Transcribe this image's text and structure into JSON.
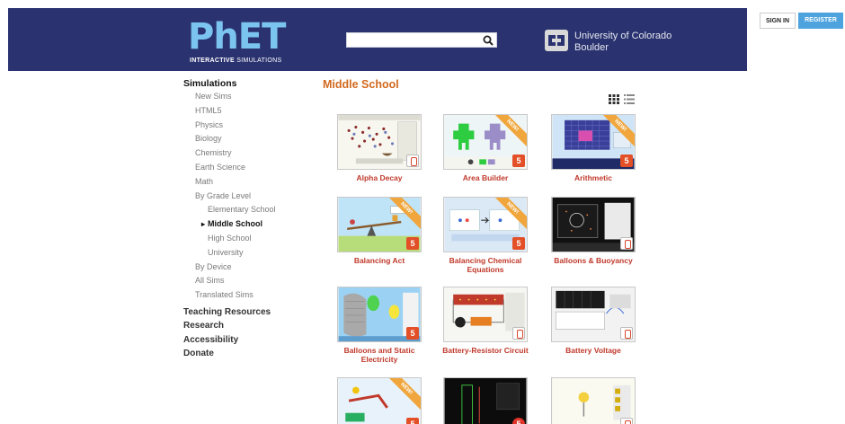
{
  "header": {
    "logo_main": "PhET",
    "logo_sub_bold": "INTERACTIVE",
    "logo_sub_rest": " SIMULATIONS",
    "search_placeholder": "",
    "university_line1": "University of Colorado",
    "university_line2": "Boulder",
    "sign_in": "SIGN IN",
    "register": "REGISTER"
  },
  "sidebar": {
    "heading": "Simulations",
    "items": [
      {
        "label": "New Sims",
        "level": 1
      },
      {
        "label": "HTML5",
        "level": 1
      },
      {
        "label": "Physics",
        "level": 1
      },
      {
        "label": "Biology",
        "level": 1
      },
      {
        "label": "Chemistry",
        "level": 1
      },
      {
        "label": "Earth Science",
        "level": 1
      },
      {
        "label": "Math",
        "level": 1
      },
      {
        "label": "By Grade Level",
        "level": 1
      },
      {
        "label": "Elementary School",
        "level": 2
      },
      {
        "label": "Middle School",
        "level": 2,
        "active": true
      },
      {
        "label": "High School",
        "level": 2
      },
      {
        "label": "University",
        "level": 2
      },
      {
        "label": "By Device",
        "level": 1
      },
      {
        "label": "All Sims",
        "level": 1
      },
      {
        "label": "Translated Sims",
        "level": 1
      }
    ],
    "sections": [
      "Teaching Resources",
      "Research",
      "Accessibility",
      "Donate"
    ]
  },
  "main": {
    "title": "Middle School",
    "view_modes": [
      "grid-icon",
      "list-icon"
    ],
    "sims": [
      {
        "label": "Alpha Decay",
        "badge": "java",
        "new": false
      },
      {
        "label": "Area Builder",
        "badge": "html5",
        "new": true
      },
      {
        "label": "Arithmetic",
        "badge": "html5",
        "new": true
      },
      {
        "label": "Balancing Act",
        "badge": "html5",
        "new": true
      },
      {
        "label": "Balancing Chemical Equations",
        "badge": "html5",
        "new": true
      },
      {
        "label": "Balloons & Buoyancy",
        "badge": "java",
        "new": false
      },
      {
        "label": "Balloons and Static Electricity",
        "badge": "html5",
        "new": false
      },
      {
        "label": "Battery-Resistor Circuit",
        "badge": "java",
        "new": false
      },
      {
        "label": "Battery Voltage",
        "badge": "java",
        "new": false
      },
      {
        "label": "",
        "badge": "html5",
        "new": true
      },
      {
        "label": "",
        "badge": "flash",
        "new": false
      },
      {
        "label": "",
        "badge": "java",
        "new": false
      }
    ],
    "new_ribbon_text": "NEW!"
  },
  "colors": {
    "header_bg": "#2a3370",
    "accent_orange": "#d2691e",
    "sim_label": "#c0392b",
    "register_bg": "#4ea3de"
  }
}
